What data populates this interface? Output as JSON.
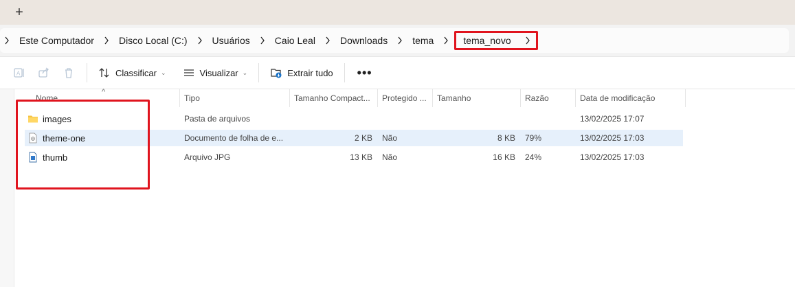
{
  "tabstrip": {
    "add_tab": "+"
  },
  "breadcrumb": {
    "items": [
      "Este Computador",
      "Disco Local (C:)",
      "Usuários",
      "Caio Leal",
      "Downloads",
      "tema"
    ],
    "current": "tema_novo"
  },
  "toolbar": {
    "sort_label": "Classificar",
    "view_label": "Visualizar",
    "extract_label": "Extrair tudo",
    "more_label": "•••"
  },
  "columns": {
    "name": "Nome",
    "type": "Tipo",
    "compressed_size": "Tamanho Compact...",
    "protected": "Protegido ...",
    "size": "Tamanho",
    "ratio": "Razão",
    "modified": "Data de modificação"
  },
  "files": [
    {
      "name": "images",
      "icon": "folder-icon",
      "type": "Pasta de arquivos",
      "compressed_size": "",
      "protected": "",
      "size": "",
      "ratio": "",
      "modified": "13/02/2025 17:07"
    },
    {
      "name": "theme-one",
      "icon": "stylesheet-file-icon",
      "type": "Documento de folha de e...",
      "compressed_size": "2 KB",
      "protected": "Não",
      "size": "8 KB",
      "ratio": "79%",
      "modified": "13/02/2025 17:03"
    },
    {
      "name": "thumb",
      "icon": "image-file-icon",
      "type": "Arquivo JPG",
      "compressed_size": "13 KB",
      "protected": "Não",
      "size": "16 KB",
      "ratio": "24%",
      "modified": "13/02/2025 17:03"
    }
  ],
  "colors": {
    "highlight": "#e0141e",
    "selected_row": "#e6f0fb",
    "folder": "#f5c342"
  }
}
